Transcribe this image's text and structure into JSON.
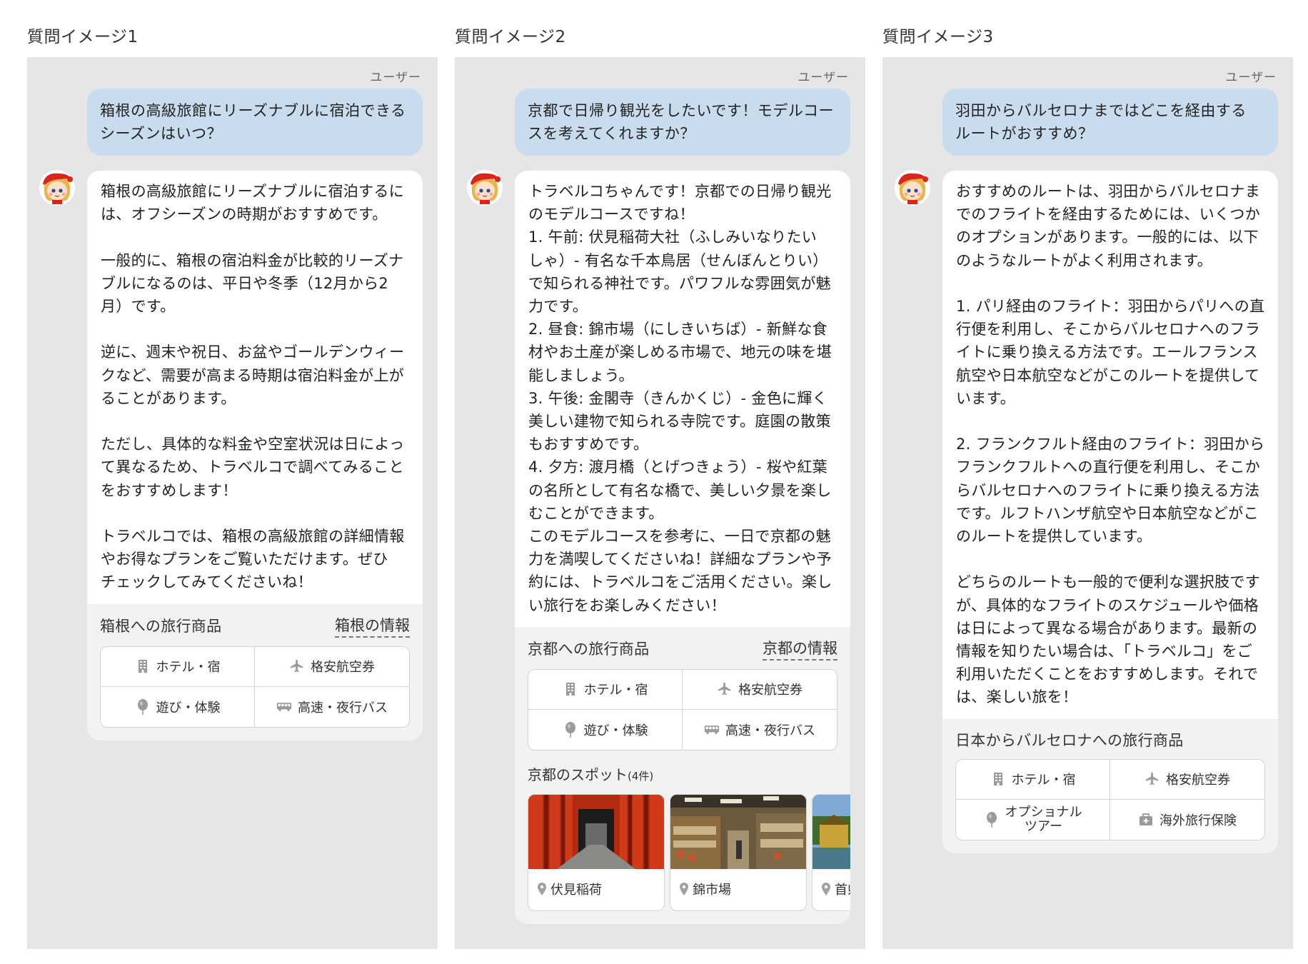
{
  "columns": [
    {
      "title": "質問イメージ1",
      "user_label": "ユーザー",
      "question": "箱根の高級旅館にリーズナブルに宿泊できる\nシーズンはいつ？",
      "answer": "箱根の高級旅館にリーズナブルに宿泊するに\nは、オフシーズンの時期がおすすめです。\n\n一般的に、箱根の宿泊料金が比較的リーズナ\nブルになるのは、平日や冬季（12月から2\n月）です。\n\n逆に、週末や祝日、お盆やゴールデンウィー\nクなど、需要が高まる時期は宿泊料金が上が\nることがあります。\n\nただし、具体的な料金や空室状況は日によっ\nて異なるため、トラベルコで調べてみること\nをおすすめします！\n\nトラベルコでは、箱根の高級旅館の詳細情報\nやお得なプランをご覧いただけます。ぜひ\nチェックしてみてくださいね！",
      "products": {
        "title": "箱根への旅行商品",
        "link": "箱根の情報",
        "items": [
          {
            "label": "ホテル・宿",
            "icon": "building-icon"
          },
          {
            "label": "格安航空券",
            "icon": "airplane-icon"
          },
          {
            "label": "遊び・体験",
            "icon": "balloon-icon"
          },
          {
            "label": "高速・夜行バス",
            "icon": "bus-icon"
          }
        ]
      }
    },
    {
      "title": "質問イメージ2",
      "user_label": "ユーザー",
      "question": "京都で日帰り観光をしたいです！モデルコー\nスを考えてくれますか？",
      "answer": "トラベルコちゃんです！京都での日帰り観光\nのモデルコースですね！\n1. 午前: 伏見稲荷大社（ふしみいなりたい\nしゃ）- 有名な千本鳥居（せんぼんとりい）\nで知られる神社です。パワフルな雰囲気が魅\n力です。\n2. 昼食: 錦市場（にしきいちば）- 新鮮な食\n材やお土産が楽しめる市場で、地元の味を堪\n能しましょう。\n3. 午後: 金閣寺（きんかくじ）- 金色に輝く\n美しい建物で知られる寺院です。庭園の散策\nもおすすめです。\n4. 夕方: 渡月橋（とげつきょう）- 桜や紅葉\nの名所として有名な橋で、美しい夕景を楽し\nむことができます。\nこのモデルコースを参考に、一日で京都の魅\n力を満喫してくださいね！詳細なプランや予\n約には、トラベルコをご活用ください。楽し\nい旅行をお楽しみください！",
      "products": {
        "title": "京都への旅行商品",
        "link": "京都の情報",
        "items": [
          {
            "label": "ホテル・宿",
            "icon": "building-icon"
          },
          {
            "label": "格安航空券",
            "icon": "airplane-icon"
          },
          {
            "label": "遊び・体験",
            "icon": "balloon-icon"
          },
          {
            "label": "高速・夜行バス",
            "icon": "bus-icon"
          }
        ]
      },
      "spots": {
        "title": "京都のスポット",
        "count": "(4件)",
        "items": [
          {
            "label": "伏見稲荷",
            "photo": "torii-gates-photo"
          },
          {
            "label": "錦市場",
            "photo": "market-photo"
          },
          {
            "label": "首県",
            "photo": "golden-temple-photo"
          }
        ]
      }
    },
    {
      "title": "質問イメージ3",
      "user_label": "ユーザー",
      "question": "羽田からバルセロナまではどこを経由する\nルートがおすすめ？",
      "answer": "おすすめのルートは、羽田からバルセロナま\nでのフライトを経由するためには、いくつか\nのオプションがあります。一般的には、以下\nのようなルートがよく利用されます。\n\n1. パリ経由のフライト：羽田からパリへの直\n行便を利用し、そこからバルセロナへのフラ\nイトに乗り換える方法です。エールフランス\n航空や日本航空などがこのルートを提供して\nいます。\n\n2. フランクフルト経由のフライト：羽田から\nフランクフルトへの直行便を利用し、そこか\nらバルセロナへのフライトに乗り換える方法\nです。ルフトハンザ航空や日本航空などがこ\nのルートを提供しています。\n\nどちらのルートも一般的で便利な選択肢です\nが、具体的なフライトのスケジュールや価格\nは日によって異なる場合があります。最新の\n情報を知りたい場合は、「トラベルコ」をご\n利用いただくことをおすすめします。それで\nは、楽しい旅を！",
      "products": {
        "title": "日本からバルセロナへの旅行商品",
        "link": "",
        "items": [
          {
            "label": "ホテル・宿",
            "icon": "building-icon"
          },
          {
            "label": "格安航空券",
            "icon": "airplane-icon"
          },
          {
            "label": "オプショナル\nツアー",
            "icon": "balloon-icon"
          },
          {
            "label": "海外旅行保険",
            "icon": "first-aid-kit-icon"
          }
        ]
      }
    }
  ],
  "colors": {
    "panel_bg": "#e6e6e6",
    "user_bubble": "#c9dcee",
    "bot_bubble": "#ffffff",
    "product_area": "#f2f2f2"
  }
}
